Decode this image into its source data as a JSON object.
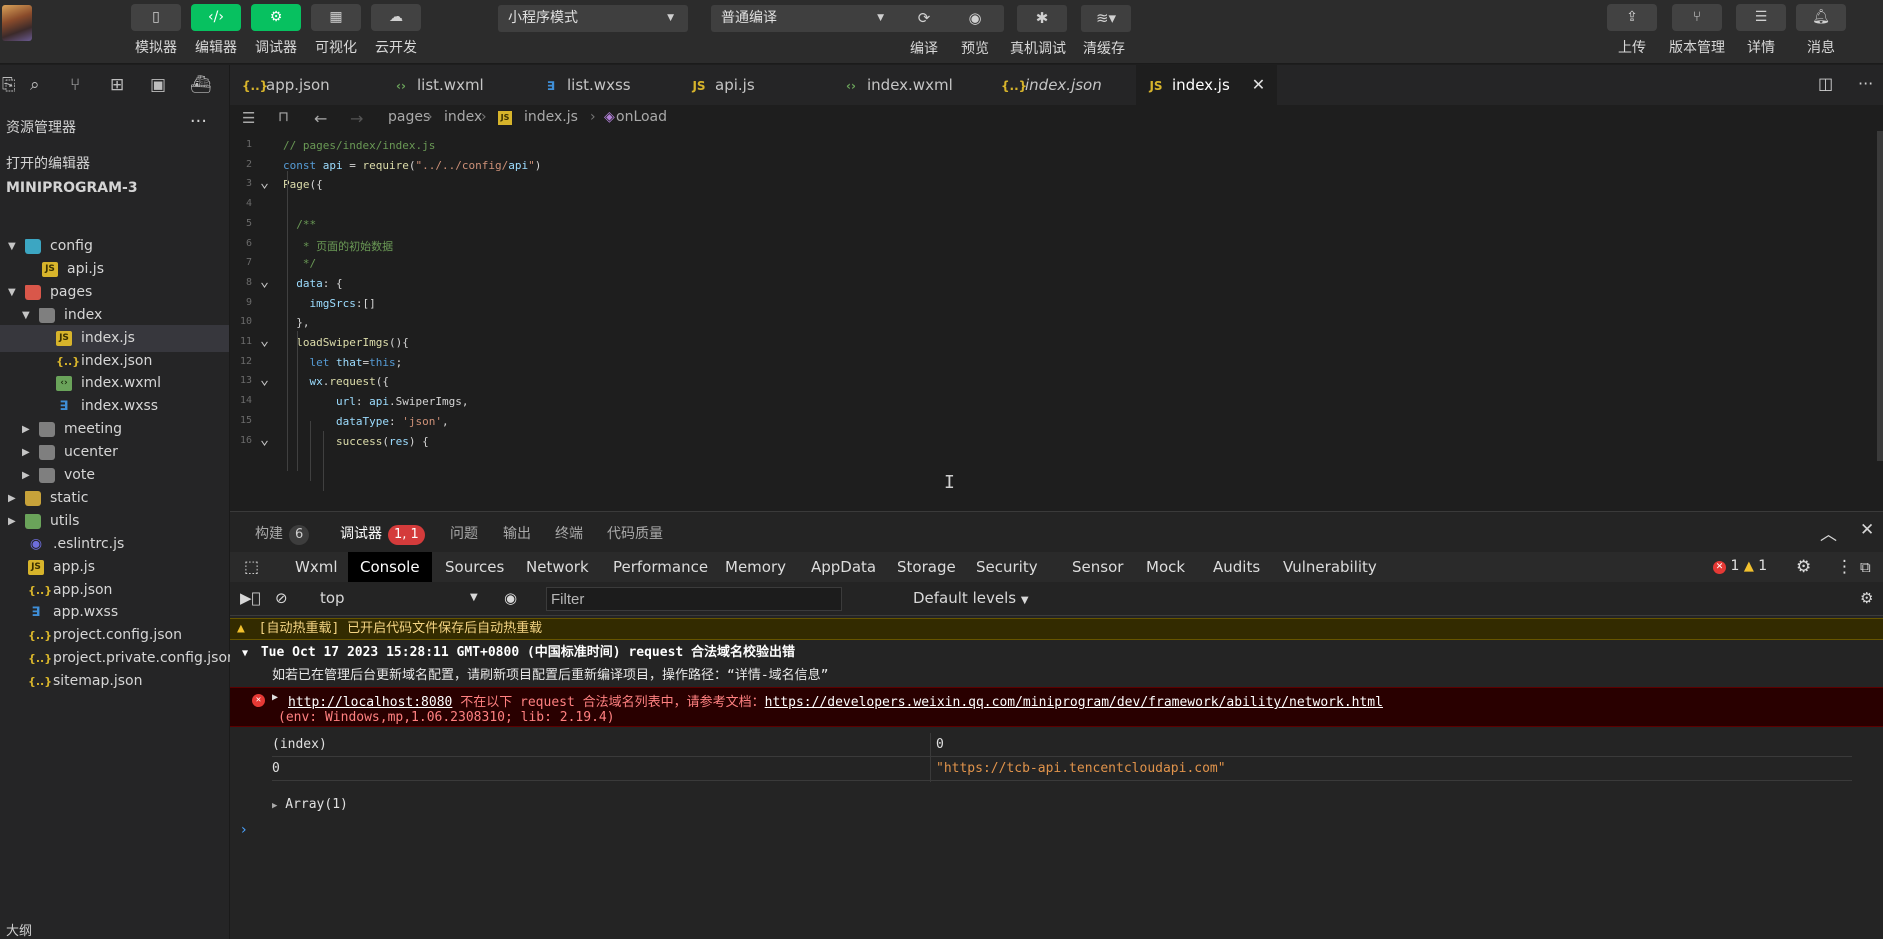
{
  "toolbar": {
    "left_buttons": [
      {
        "label": "模拟器",
        "icon": "phone-icon"
      },
      {
        "label": "编辑器",
        "icon": "code-icon"
      },
      {
        "label": "调试器",
        "icon": "sliders-icon"
      },
      {
        "label": "可视化",
        "icon": "layout-icon"
      },
      {
        "label": "云开发",
        "icon": "cloud-icon"
      }
    ],
    "mode_select": "小程序模式",
    "compile_select": "普通编译",
    "compile_actions": [
      {
        "label": "编译",
        "icon": "refresh-icon"
      },
      {
        "label": "预览",
        "icon": "eye-icon"
      },
      {
        "label": "真机调试",
        "icon": "bug-icon"
      },
      {
        "label": "清缓存",
        "icon": "layers-icon"
      }
    ],
    "right_buttons": [
      {
        "label": "上传",
        "icon": "upload-icon"
      },
      {
        "label": "版本管理",
        "icon": "branch-icon"
      },
      {
        "label": "详情",
        "icon": "menu-icon"
      },
      {
        "label": "消息",
        "icon": "bell-icon"
      }
    ]
  },
  "sidebar": {
    "title": "资源管理器",
    "open_editors": "打开的编辑器",
    "project": "MINIPROGRAM-3",
    "tree": [
      {
        "name": "config",
        "type": "folder-teal",
        "depth": 0,
        "open": true
      },
      {
        "name": "api.js",
        "type": "js",
        "depth": 1
      },
      {
        "name": "pages",
        "type": "folder-red",
        "depth": 0,
        "open": true
      },
      {
        "name": "index",
        "type": "folder-gray",
        "depth": 1,
        "open": true
      },
      {
        "name": "index.js",
        "type": "js",
        "depth": 2,
        "selected": true
      },
      {
        "name": "index.json",
        "type": "json",
        "depth": 2
      },
      {
        "name": "index.wxml",
        "type": "wxml",
        "depth": 2
      },
      {
        "name": "index.wxss",
        "type": "wxss",
        "depth": 2
      },
      {
        "name": "meeting",
        "type": "folder-gray",
        "depth": 1,
        "open": false
      },
      {
        "name": "ucenter",
        "type": "folder-gray",
        "depth": 1,
        "open": false
      },
      {
        "name": "vote",
        "type": "folder-gray",
        "depth": 1,
        "open": false
      },
      {
        "name": "static",
        "type": "folder",
        "depth": 0,
        "open": false
      },
      {
        "name": "utils",
        "type": "folder-green",
        "depth": 0,
        "open": false
      },
      {
        "name": ".eslintrc.js",
        "type": "eslint",
        "depth": 0
      },
      {
        "name": "app.js",
        "type": "js",
        "depth": 0
      },
      {
        "name": "app.json",
        "type": "json",
        "depth": 0
      },
      {
        "name": "app.wxss",
        "type": "wxss",
        "depth": 0
      },
      {
        "name": "project.config.json",
        "type": "json",
        "depth": 0
      },
      {
        "name": "project.private.config.json",
        "type": "json",
        "depth": 0
      },
      {
        "name": "sitemap.json",
        "type": "json",
        "depth": 0
      }
    ],
    "outline": "大纲"
  },
  "editor": {
    "tabs": [
      {
        "name": "app.json",
        "type": "json"
      },
      {
        "name": "list.wxml",
        "type": "wxml"
      },
      {
        "name": "list.wxss",
        "type": "wxss"
      },
      {
        "name": "api.js",
        "type": "js"
      },
      {
        "name": "index.wxml",
        "type": "wxml"
      },
      {
        "name": "index.json",
        "type": "json",
        "italic": true
      },
      {
        "name": "index.js",
        "type": "js",
        "active": true
      }
    ],
    "breadcrumb": [
      "pages",
      "index",
      "index.js",
      "onLoad"
    ],
    "lines": [
      {
        "n": "1",
        "text": "// pages/index/index.js"
      },
      {
        "n": "2",
        "text": "const api = require(\"../../config/api\")"
      },
      {
        "n": "3",
        "text": "Page({"
      },
      {
        "n": "4",
        "text": ""
      },
      {
        "n": "5",
        "text": "  /**"
      },
      {
        "n": "6",
        "text": "   * 页面的初始数据"
      },
      {
        "n": "7",
        "text": "   */"
      },
      {
        "n": "8",
        "text": "  data: {"
      },
      {
        "n": "9",
        "text": "    imgSrcs:[]"
      },
      {
        "n": "10",
        "text": "  },"
      },
      {
        "n": "11",
        "text": "  loadSwiperImgs(){"
      },
      {
        "n": "12",
        "text": "    let that=this;"
      },
      {
        "n": "13",
        "text": "    wx.request({"
      },
      {
        "n": "14",
        "text": "        url: api.SwiperImgs,"
      },
      {
        "n": "15",
        "text": "        dataType: 'json',"
      },
      {
        "n": "16",
        "text": "        success(res) {"
      }
    ]
  },
  "panel": {
    "tabs": [
      {
        "label": "构建",
        "badge": "6"
      },
      {
        "label": "调试器",
        "badge": "1, 1",
        "active": true
      },
      {
        "label": "问题"
      },
      {
        "label": "输出"
      },
      {
        "label": "终端"
      },
      {
        "label": "代码质量"
      }
    ],
    "devtools_tabs": [
      "Wxml",
      "Console",
      "Sources",
      "Network",
      "Performance",
      "Memory",
      "AppData",
      "Storage",
      "Security",
      "Sensor",
      "Mock",
      "Audits",
      "Vulnerability"
    ],
    "active_devtools_tab": "Console",
    "error_count": "1",
    "warning_count": "1",
    "context": "top",
    "filter_placeholder": "Filter",
    "levels": "Default levels",
    "console": {
      "warning": "[自动热重载] 已开启代码文件保存后自动热重载",
      "group_header": "Tue Oct 17 2023 15:28:11 GMT+0800 (中国标准时间) request 合法域名校验出错",
      "info": "如若已在管理后台更新域名配置，请刷新项目配置后重新编译项目，操作路径：“详情-域名信息”",
      "error_link": "http://localhost:8080",
      "error_text": " 不在以下 request 合法域名列表中，请参考文档：",
      "error_doc": "https://developers.weixin.qq.com/miniprogram/dev/framework/ability/network.html",
      "error_env": "(env: Windows,mp,1.06.2308310; lib: 2.19.4)",
      "table_headers": [
        "(index)",
        "0"
      ],
      "table_row": [
        "0",
        "\"https://tcb-api.tencentcloudapi.com\""
      ],
      "array_label": "Array(1)"
    }
  }
}
